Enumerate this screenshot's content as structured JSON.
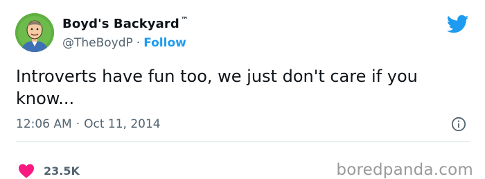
{
  "author": {
    "display_name": "Boyd's Backyard",
    "trademark": "™",
    "handle": "@TheBoydP",
    "separator": "·",
    "follow_label": "Follow"
  },
  "tweet": {
    "text": "Introverts have fun too, we just don't care if you know...",
    "time": "12:06 AM",
    "time_separator": "·",
    "date": "Oct 11, 2014"
  },
  "engagement": {
    "like_count": "23.5K"
  },
  "watermark": "boredpanda.com",
  "icons": {
    "brand": "twitter-bird-icon",
    "info": "info-icon",
    "like": "heart-icon"
  },
  "colors": {
    "accent": "#1d9bf0",
    "like": "#f91880",
    "secondary_text": "#536471",
    "primary_text": "#0f1419",
    "avatar_background": "#5fb040"
  }
}
